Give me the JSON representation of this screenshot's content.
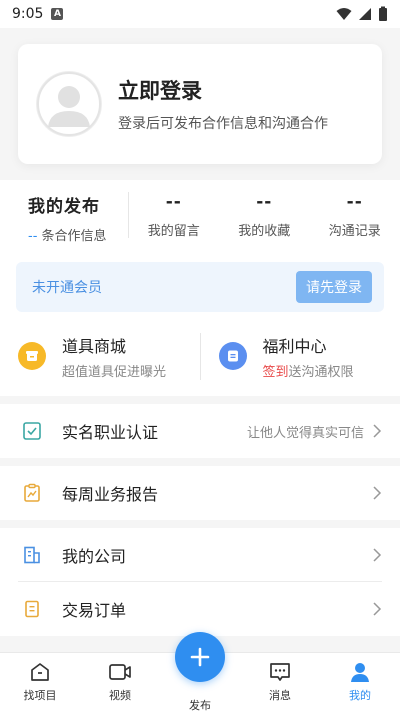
{
  "status": {
    "time": "9:05",
    "a_badge": "A"
  },
  "profile": {
    "title": "立即登录",
    "subtitle": "登录后可发布合作信息和沟通合作"
  },
  "stats": [
    {
      "value": "我的发布",
      "label_prefix": "--",
      "label": " 条合作信息"
    },
    {
      "value": "--",
      "label": "我的留言"
    },
    {
      "value": "--",
      "label": "我的收藏"
    },
    {
      "value": "--",
      "label": "沟通记录"
    }
  ],
  "vip": {
    "text": "未开通会员",
    "button": "请先登录"
  },
  "features": [
    {
      "title": "道具商城",
      "sub": "超值道具促进曝光",
      "icon": "shop-icon",
      "color": "#f7b928"
    },
    {
      "title": "福利中心",
      "sub_red": "签到",
      "sub": "送沟通权限",
      "icon": "gift-card-icon",
      "color": "#5b8ff0"
    }
  ],
  "list": [
    {
      "label": "实名职业认证",
      "hint": "让他人觉得真实可信",
      "icon": "verify-icon"
    },
    {
      "label": "每周业务报告",
      "icon": "report-icon"
    },
    {
      "label": "我的公司",
      "icon": "company-icon"
    },
    {
      "label": "交易订单",
      "icon": "order-icon"
    }
  ],
  "tabs": [
    {
      "label": "找项目",
      "icon": "home-icon"
    },
    {
      "label": "视频",
      "icon": "video-icon"
    },
    {
      "label": "发布",
      "icon": "plus-icon"
    },
    {
      "label": "消息",
      "icon": "message-icon"
    },
    {
      "label": "我的",
      "icon": "user-icon",
      "active": true
    }
  ],
  "colors": {
    "accent": "#2f8ef0",
    "vip_bg": "#eef5fd",
    "vip_btn": "#7fb6f2",
    "red": "#e84a4a"
  }
}
